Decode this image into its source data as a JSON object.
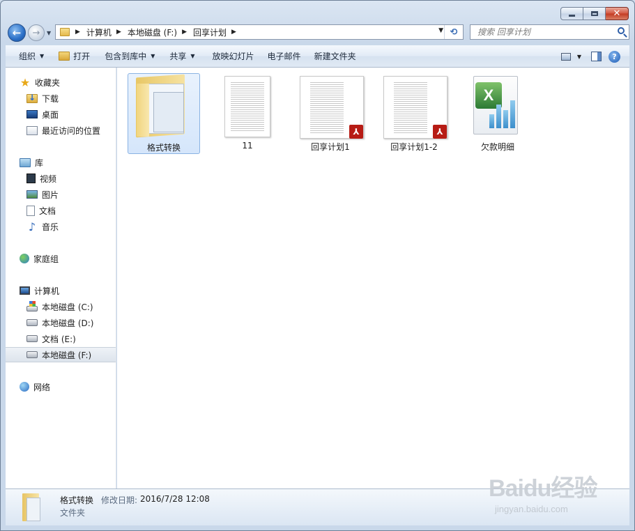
{
  "address": {
    "crumbs": [
      "计算机",
      "本地磁盘 (F:)",
      "回享计划"
    ]
  },
  "search": {
    "placeholder": "搜索 回享计划"
  },
  "toolbar": {
    "organize": "组织",
    "open": "打开",
    "include_in_library": "包含到库中",
    "share": "共享",
    "slideshow": "放映幻灯片",
    "email": "电子邮件",
    "new_folder": "新建文件夹"
  },
  "sidebar": {
    "favorites": {
      "label": "收藏夹",
      "items": [
        "下载",
        "桌面",
        "最近访问的位置"
      ]
    },
    "libraries": {
      "label": "库",
      "items": [
        "视频",
        "图片",
        "文档",
        "音乐"
      ]
    },
    "homegroup": "家庭组",
    "computer": {
      "label": "计算机",
      "items": [
        "本地磁盘 (C:)",
        "本地磁盘 (D:)",
        "文档 (E:)",
        "本地磁盘 (F:)"
      ]
    },
    "network": "网络"
  },
  "files": [
    {
      "name": "格式转换",
      "type": "folder"
    },
    {
      "name": "11",
      "type": "document"
    },
    {
      "name": "回享计划1",
      "type": "pdf"
    },
    {
      "name": "回享计划1-2",
      "type": "pdf"
    },
    {
      "name": "欠款明细",
      "type": "excel"
    }
  ],
  "details": {
    "name": "格式转换",
    "modified_label": "修改日期:",
    "modified_value": "2016/7/28 12:08",
    "type": "文件夹"
  },
  "watermark": {
    "brand": "Baidu经验",
    "url": "jingyan.baidu.com"
  },
  "colors": {
    "selection": "#d5e6fb",
    "pdf": "#b71c15",
    "excel": "#2c7a35"
  }
}
